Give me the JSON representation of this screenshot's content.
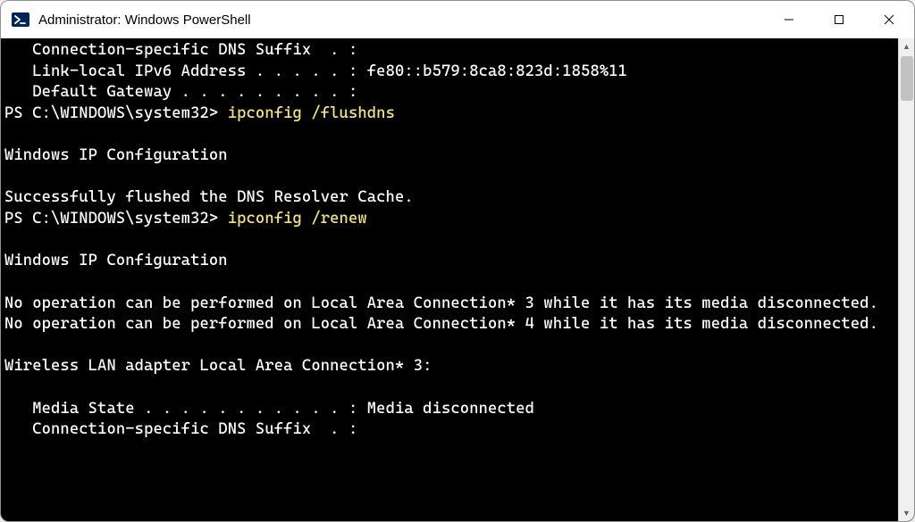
{
  "window": {
    "title": "Administrator: Windows PowerShell"
  },
  "terminal": {
    "lines": [
      {
        "segments": [
          {
            "t": "   Connection-specific DNS Suffix  . :"
          }
        ]
      },
      {
        "segments": [
          {
            "t": "   Link-local IPv6 Address . . . . . : fe80::b579:8ca8:823d:1858%11"
          }
        ]
      },
      {
        "segments": [
          {
            "t": "   Default Gateway . . . . . . . . . :"
          }
        ]
      },
      {
        "segments": [
          {
            "t": "PS C:\\WINDOWS\\system32> "
          },
          {
            "t": "ipconfig /flushdns",
            "cls": "cmd"
          }
        ]
      },
      {
        "segments": [
          {
            "t": ""
          }
        ]
      },
      {
        "segments": [
          {
            "t": "Windows IP Configuration"
          }
        ]
      },
      {
        "segments": [
          {
            "t": ""
          }
        ]
      },
      {
        "segments": [
          {
            "t": "Successfully flushed the DNS Resolver Cache."
          }
        ]
      },
      {
        "segments": [
          {
            "t": "PS C:\\WINDOWS\\system32> "
          },
          {
            "t": "ipconfig /renew",
            "cls": "cmd"
          }
        ]
      },
      {
        "segments": [
          {
            "t": ""
          }
        ]
      },
      {
        "segments": [
          {
            "t": "Windows IP Configuration"
          }
        ]
      },
      {
        "segments": [
          {
            "t": ""
          }
        ]
      },
      {
        "segments": [
          {
            "t": "No operation can be performed on Local Area Connection* 3 while it has its media disconnected."
          }
        ]
      },
      {
        "segments": [
          {
            "t": "No operation can be performed on Local Area Connection* 4 while it has its media disconnected."
          }
        ]
      },
      {
        "segments": [
          {
            "t": ""
          }
        ]
      },
      {
        "segments": [
          {
            "t": "Wireless LAN adapter Local Area Connection* 3:"
          }
        ]
      },
      {
        "segments": [
          {
            "t": ""
          }
        ]
      },
      {
        "segments": [
          {
            "t": "   Media State . . . . . . . . . . . : Media disconnected"
          }
        ]
      },
      {
        "segments": [
          {
            "t": "   Connection-specific DNS Suffix  . :"
          }
        ]
      }
    ]
  }
}
